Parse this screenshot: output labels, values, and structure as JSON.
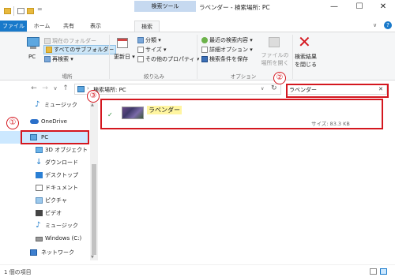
{
  "window": {
    "tool_tab": "検索ツール",
    "title": "ラベンダー - 検索場所: PC",
    "minimize": "—",
    "maximize": "☐",
    "close": "✕",
    "chevron": "∨",
    "help": "?"
  },
  "ribbon": {
    "tabs": [
      "ファイル",
      "ホーム",
      "共有",
      "表示",
      "検索"
    ],
    "location": {
      "pc_label": "PC",
      "current_folder": "現在のフォルダー",
      "all_subfolders": "すべてのサブフォルダー",
      "search_again": "再検索 ▾",
      "group": "場所"
    },
    "refine": {
      "date_modified": "更新日 ▾",
      "kind": "分類 ▾",
      "size": "サイズ ▾",
      "other_props": "その他のプロパティ ▾",
      "group": "絞り込み"
    },
    "options": {
      "recent": "最近の検索内容 ▾",
      "advanced": "詳細オプション ▾",
      "save": "検索条件を保存",
      "open_location_1": "ファイルの",
      "open_location_2": "場所を開く",
      "group": "オプション"
    },
    "close_search_1": "検索結果",
    "close_search_2": "を閉じる"
  },
  "address": {
    "back": "←",
    "forward": "→",
    "recent": "∨",
    "up": "↑",
    "path": "検索場所: PC",
    "path_prefix": "›",
    "path_dropdown": "∨",
    "refresh": "↻",
    "search_value": "ラベンダー",
    "search_clear": "✕"
  },
  "nav": {
    "items": [
      {
        "label": "ミュージック"
      },
      {
        "label": "OneDrive"
      },
      {
        "label": "PC"
      },
      {
        "label": "3D オブジェクト"
      },
      {
        "label": "ダウンロード"
      },
      {
        "label": "デスクトップ"
      },
      {
        "label": "ドキュメント"
      },
      {
        "label": "ピクチャ"
      },
      {
        "label": "ビデオ"
      },
      {
        "label": "ミュージック"
      },
      {
        "label": "Windows (C:)"
      },
      {
        "label": "ネットワーク"
      }
    ],
    "scroll_up": "▲",
    "scroll_down": "▼"
  },
  "results": [
    {
      "name": "ラベンダー",
      "size_text": "サイズ: 83.3 KB",
      "status": "✓"
    }
  ],
  "status": {
    "count": "1 個の項目"
  },
  "annotations": [
    "①",
    "②",
    "③"
  ],
  "colors": {
    "accent": "#1979ca",
    "annotation_red": "#d4171f",
    "selection": "#cce8ff"
  }
}
